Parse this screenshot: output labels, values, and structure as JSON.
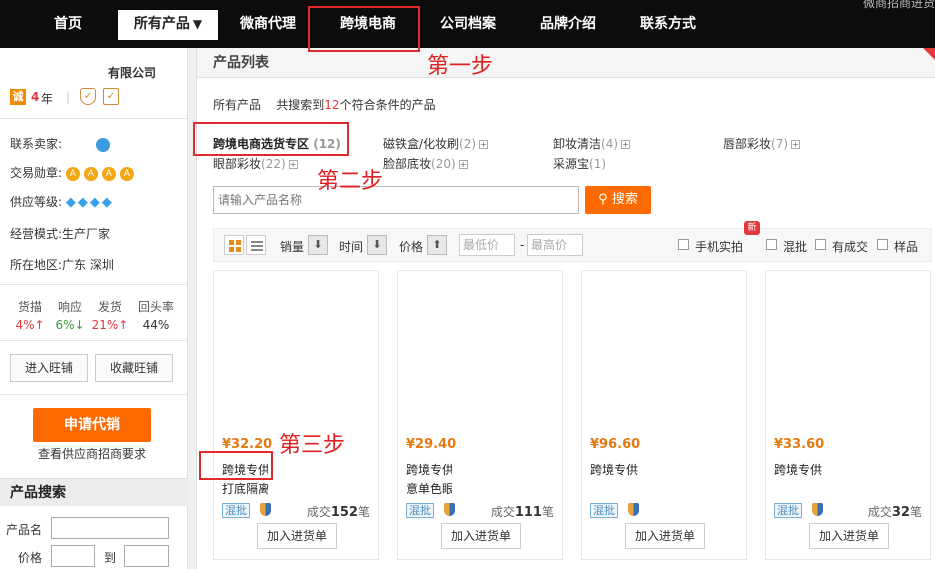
{
  "nav": {
    "items": [
      "首页",
      "所有产品",
      "微商代理",
      "跨境电商",
      "公司档案",
      "品牌介绍",
      "联系方式"
    ],
    "active_caret": "▼",
    "top_text": "微商招商进货"
  },
  "annotations": {
    "step1": "第一步",
    "step2": "第二步",
    "step3": "第三步"
  },
  "company": {
    "name": "有限公司",
    "cheng_badge": "诚",
    "years_num": "4",
    "years_unit": "年",
    "divider": "|"
  },
  "seller": {
    "contact_label": "联系卖家:",
    "medal_label": "交易勋章:",
    "level_label": "供应等级:",
    "mode_label": "经营模式:",
    "mode_value": "生产厂家",
    "region_label": "所在地区:",
    "region_value": "广东 深圳",
    "medals": [
      "A",
      "A",
      "A",
      "A"
    ],
    "diamonds": [
      "◆",
      "◆",
      "◆",
      "◆"
    ]
  },
  "stats": [
    {
      "label": "货描",
      "value": "4%↑",
      "trend": "up"
    },
    {
      "label": "响应",
      "value": "6%↓",
      "trend": "down"
    },
    {
      "label": "发货",
      "value": "21%↑",
      "trend": "up"
    },
    {
      "label": "回头率",
      "value": "44%",
      "trend": "none"
    }
  ],
  "left_buttons": {
    "enter_shop": "进入旺铺",
    "fav_shop": "收藏旺铺",
    "apply": "申请代销",
    "apply_note": "查看供应商招商要求"
  },
  "product_search": {
    "title": "产品搜索",
    "name_label": "产品名",
    "price_label": "价格",
    "to_label": "到"
  },
  "main": {
    "header": "产品列表",
    "summary_all": "所有产品",
    "summary_pre": "共搜索到",
    "summary_count": "12",
    "summary_post": "个符合条件的产品",
    "categories": [
      {
        "name": "跨境电商选货专区",
        "count": "(12)"
      },
      {
        "name": "磁铁盒/化妆刷",
        "count": "(2)"
      },
      {
        "name": "卸妆清洁",
        "count": "(4)"
      },
      {
        "name": "唇部彩妆",
        "count": "(7)"
      },
      {
        "name": "眼部彩妆",
        "count": "(22)"
      },
      {
        "name": "脸部底妆",
        "count": "(20)"
      },
      {
        "name": "采源宝",
        "count": "(1)"
      }
    ],
    "plus": "+",
    "search_placeholder": "请输入产品名称",
    "search_button": "搜索",
    "search_icon_glyph": "⚲"
  },
  "filters": {
    "sales": "销量",
    "time": "时间",
    "price": "价格",
    "arrow_down": "⬇",
    "arrow_up": "⬆",
    "price_min": "最低价",
    "price_max": "最高价",
    "dash": "-",
    "phone_photo": "手机实拍",
    "new_badge": "新",
    "mixed": "混批",
    "has_deal": "有成交",
    "sample": "样品"
  },
  "products": [
    {
      "price": "¥32.20",
      "title": "跨境专供",
      "title2": "打底隔离霜",
      "deal_pre": "成交",
      "deal_num": "152",
      "deal_unit": "笔",
      "tag": "混批",
      "add": "加入进货单"
    },
    {
      "price": "¥29.40",
      "title": "跨境专供",
      "title2": "意单色眼影",
      "deal_pre": "成交",
      "deal_num": "111",
      "deal_unit": "笔",
      "tag": "混批",
      "add": "加入进货单"
    },
    {
      "price": "¥96.60",
      "title": "跨境专供",
      "title2": "",
      "deal_pre": "",
      "deal_num": "",
      "deal_unit": "",
      "tag": "混批",
      "add": "加入进货单"
    },
    {
      "price": "¥33.60",
      "title": "跨境专供",
      "title2": "",
      "deal_pre": "成交",
      "deal_num": "32",
      "deal_unit": "笔",
      "tag": "混批",
      "add": "加入进货单"
    }
  ],
  "colors": {
    "accent_orange": "#ff6a00",
    "annotation_red": "#e02020",
    "price_orange": "#e47911",
    "nav_bg": "#0c0c0c"
  }
}
